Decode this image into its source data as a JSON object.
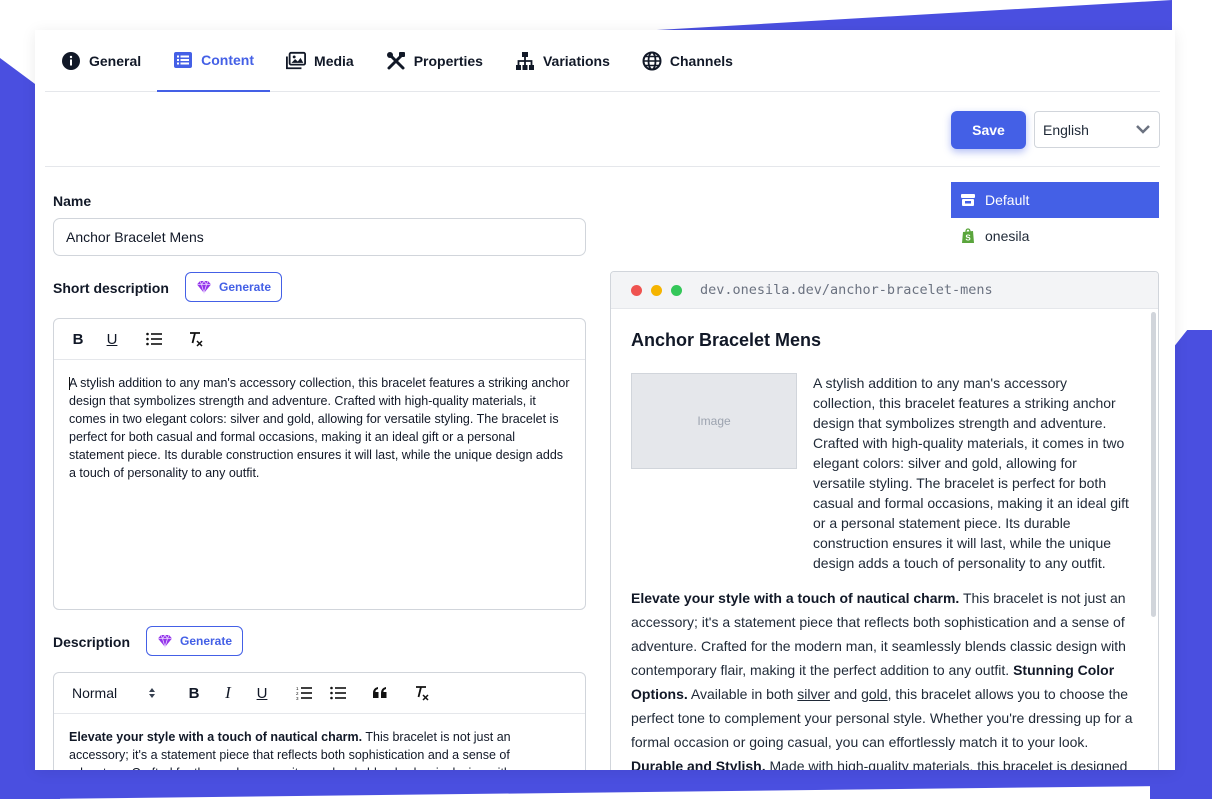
{
  "tabs": [
    {
      "label": "General",
      "icon": "info-icon"
    },
    {
      "label": "Content",
      "icon": "list-icon",
      "active": true
    },
    {
      "label": "Media",
      "icon": "images-icon"
    },
    {
      "label": "Properties",
      "icon": "tools-icon"
    },
    {
      "label": "Variations",
      "icon": "sitemap-icon"
    },
    {
      "label": "Channels",
      "icon": "globe-icon"
    }
  ],
  "toolbar": {
    "save_label": "Save",
    "language": "English"
  },
  "channels": [
    {
      "label": "Default",
      "icon": "store-icon",
      "active": true
    },
    {
      "label": "onesila",
      "icon": "shopify-icon"
    }
  ],
  "form": {
    "name_label": "Name",
    "name_value": "Anchor Bracelet Mens",
    "short_label": "Short description",
    "generate_label": "Generate",
    "short_text": "A stylish addition to any man's accessory collection, this bracelet features a striking anchor design that symbolizes strength and adventure. Crafted with high-quality materials, it comes in two elegant colors: silver and gold, allowing for versatile styling. The bracelet is perfect for both casual and formal occasions, making it an ideal gift or a personal statement piece. Its durable construction ensures it will last, while the unique design adds a touch of personality to any outfit.",
    "desc_label": "Description",
    "format_select": "Normal",
    "desc_bold": "Elevate your style with a touch of nautical charm.",
    "desc_text": " This bracelet is not just an accessory; it's a statement piece that reflects both sophistication and a sense of adventure. Crafted for the modern man, it seamlessly blends classic design with contemporary flair, making it the perfect addition to any outfit."
  },
  "preview": {
    "url": "dev.onesila.dev/anchor-bracelet-mens",
    "title": "Anchor Bracelet Mens",
    "image_placeholder": "Image",
    "short_text": "A stylish addition to any man's accessory collection, this bracelet features a striking anchor design that symbolizes strength and adventure. Crafted with high-quality materials, it comes in two elegant colors: silver and gold, allowing for versatile styling. The bracelet is perfect for both casual and formal occasions, making it an ideal gift or a personal statement piece. Its durable construction ensures it will last, while the unique design adds a touch of personality to any outfit.",
    "p1_bold": "Elevate your style with a touch of nautical charm.",
    "p1_text": " This bracelet is not just an accessory; it's a statement piece that reflects both sophistication and a sense of adventure. Crafted for the modern man, it seamlessly blends classic design with contemporary flair, making it the perfect addition to any outfit. ",
    "p2_bold": "Stunning Color Options.",
    "p2_a": " Available in both ",
    "p2_silver": "silver",
    "p2_and": " and ",
    "p2_gold": "gold",
    "p2_b": ", this bracelet allows you to choose the perfect tone to complement your personal style. Whether you're dressing up for a formal occasion or going casual, you can effortlessly match it to your look.",
    "p3_bold": "Durable and Stylish.",
    "p3_text": " Made with high-quality materials, this bracelet is designed"
  },
  "colors": {
    "accent": "#4460e6",
    "brand_bg": "#4a4fe0",
    "generate_icon": "#9333ea"
  }
}
